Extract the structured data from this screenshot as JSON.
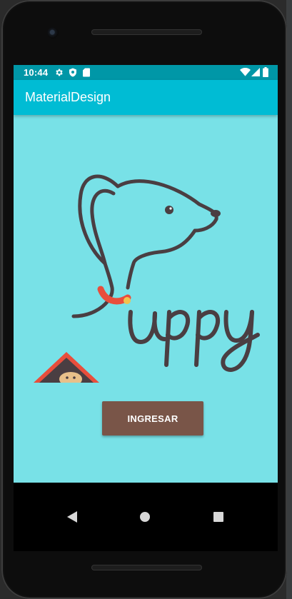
{
  "status_bar": {
    "time": "10:44",
    "left_icons": [
      "settings-icon",
      "shield-icon",
      "sd-card-icon"
    ],
    "right_icons": [
      "wifi-icon",
      "signal-icon",
      "battery-icon"
    ]
  },
  "app_bar": {
    "title": "MaterialDesign"
  },
  "main": {
    "logo": {
      "text": "uppy",
      "icon": "dog-logo"
    },
    "button": {
      "label": "INGRESAR"
    }
  },
  "nav_bar": {
    "buttons": [
      "back-icon",
      "home-icon",
      "recents-icon"
    ]
  },
  "colors": {
    "status_bar": "#0097a7",
    "app_bar": "#00bcd4",
    "background": "#78e1e7",
    "button": "#795548",
    "logo_ink": "#4a3e42",
    "collar": "#e84e3c"
  }
}
